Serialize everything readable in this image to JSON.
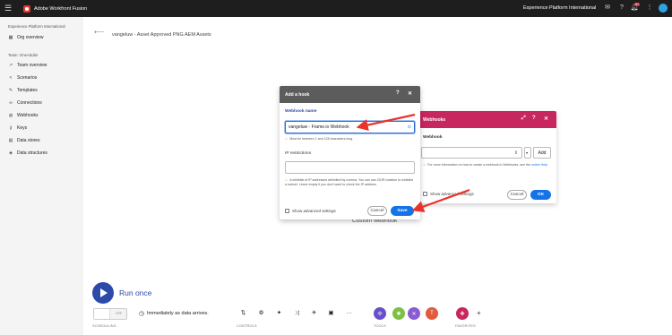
{
  "app": {
    "title": "Adobe Workfront Fusion",
    "org": "Experience Platform International",
    "notification_count": "9+"
  },
  "sidebar": {
    "org_section": "Experience Platform International",
    "org_overview": "Org overview",
    "team_section": "Team: OneAdobe",
    "items": [
      {
        "label": "Team overview",
        "icon": "chart-icon"
      },
      {
        "label": "Scenarios",
        "icon": "share-icon"
      },
      {
        "label": "Templates",
        "icon": "brush-icon"
      },
      {
        "label": "Connections",
        "icon": "link-icon"
      },
      {
        "label": "Webhooks",
        "icon": "globe-icon"
      },
      {
        "label": "Keys",
        "icon": "key-icon"
      },
      {
        "label": "Data stores",
        "icon": "database-icon"
      },
      {
        "label": "Data structures",
        "icon": "cube-icon"
      }
    ]
  },
  "scenario": {
    "name": "vangeluw - Asset Approved PNG AEM Assets",
    "module_label": "Custom webhook"
  },
  "add_hook_dialog": {
    "title": "Add a hook",
    "webhook_name_label": "Webhook name",
    "webhook_name_value": "vangeluw - Frame.io Webhook",
    "name_hint": "Must be between 1 and 128 characters long.",
    "ip_label": "IP restrictions",
    "ip_value": "",
    "ip_hint": "A whitelist of IP addresses delimited by comma. You can use CIDR notation to whitelist a subnet. Leave empty if you don't want to check the IP address.",
    "advanced_label": "Show advanced settings",
    "cancel_label": "Cancel",
    "save_label": "Save"
  },
  "webhooks_dialog": {
    "title": "Webhooks",
    "webhook_label": "Webhook",
    "add_label": "Add",
    "hint_prefix": "For more information on how to create a webhook in Webhooks, see the",
    "hint_link": "online Help",
    "advanced_label": "Show advanced settings",
    "cancel_label": "Cancel",
    "ok_label": "OK"
  },
  "bottom": {
    "run_label": "Run once",
    "toggle_label": "OFF",
    "schedule_text": "Immediately as data arrives.",
    "scheduling_caption": "SCHEDULING",
    "controls_caption": "CONTROLS",
    "tools_caption": "TOOLS",
    "favorites_caption": "FAVORITES",
    "more_label": "···",
    "add_label": "+"
  },
  "colors": {
    "brand_red": "#e63b2e",
    "primary_blue": "#1473e6",
    "webhooks_header": "#c8265e",
    "annotation_arrow": "#e8342b"
  }
}
